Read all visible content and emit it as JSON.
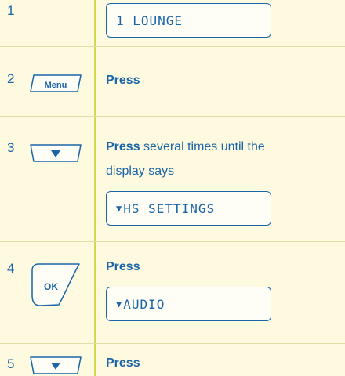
{
  "steps": [
    {
      "number": "1",
      "display": "1 LOUNGE"
    },
    {
      "number": "2",
      "key": "Menu",
      "action": "Press"
    },
    {
      "number": "3",
      "key_icon": "down-arrow-key",
      "action": "Press",
      "text_line1": "several times until the",
      "text_line2": "display says",
      "display": "HS SETTINGS"
    },
    {
      "number": "4",
      "key": "OK",
      "action": "Press",
      "display": "AUDIO"
    },
    {
      "number": "5",
      "key_icon": "down-arrow-key",
      "action": "Press"
    }
  ],
  "colors": {
    "background": "#fefadf",
    "text": "#1a64a8",
    "divider": "#d3d84c"
  }
}
